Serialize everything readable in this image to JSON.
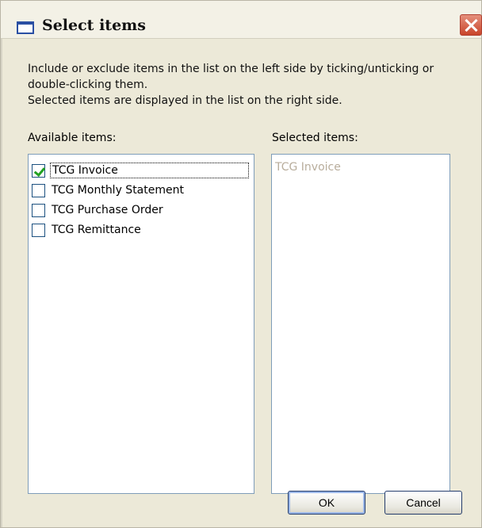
{
  "window": {
    "title": "Select items"
  },
  "intro": {
    "line1": "Include or exclude items in the list on the left side by ticking/unticking or",
    "line2": "double-clicking them.",
    "line3": "Selected items are displayed in the list on the right side."
  },
  "available": {
    "label": "Available items:",
    "items": [
      {
        "label": "TCG Invoice",
        "checked": true
      },
      {
        "label": "TCG Monthly Statement",
        "checked": false
      },
      {
        "label": "TCG Purchase Order",
        "checked": false
      },
      {
        "label": "TCG Remittance",
        "checked": false
      }
    ]
  },
  "selected": {
    "label": "Selected items:",
    "items": [
      "TCG Invoice"
    ]
  },
  "buttons": {
    "ok": "OK",
    "cancel": "Cancel"
  }
}
